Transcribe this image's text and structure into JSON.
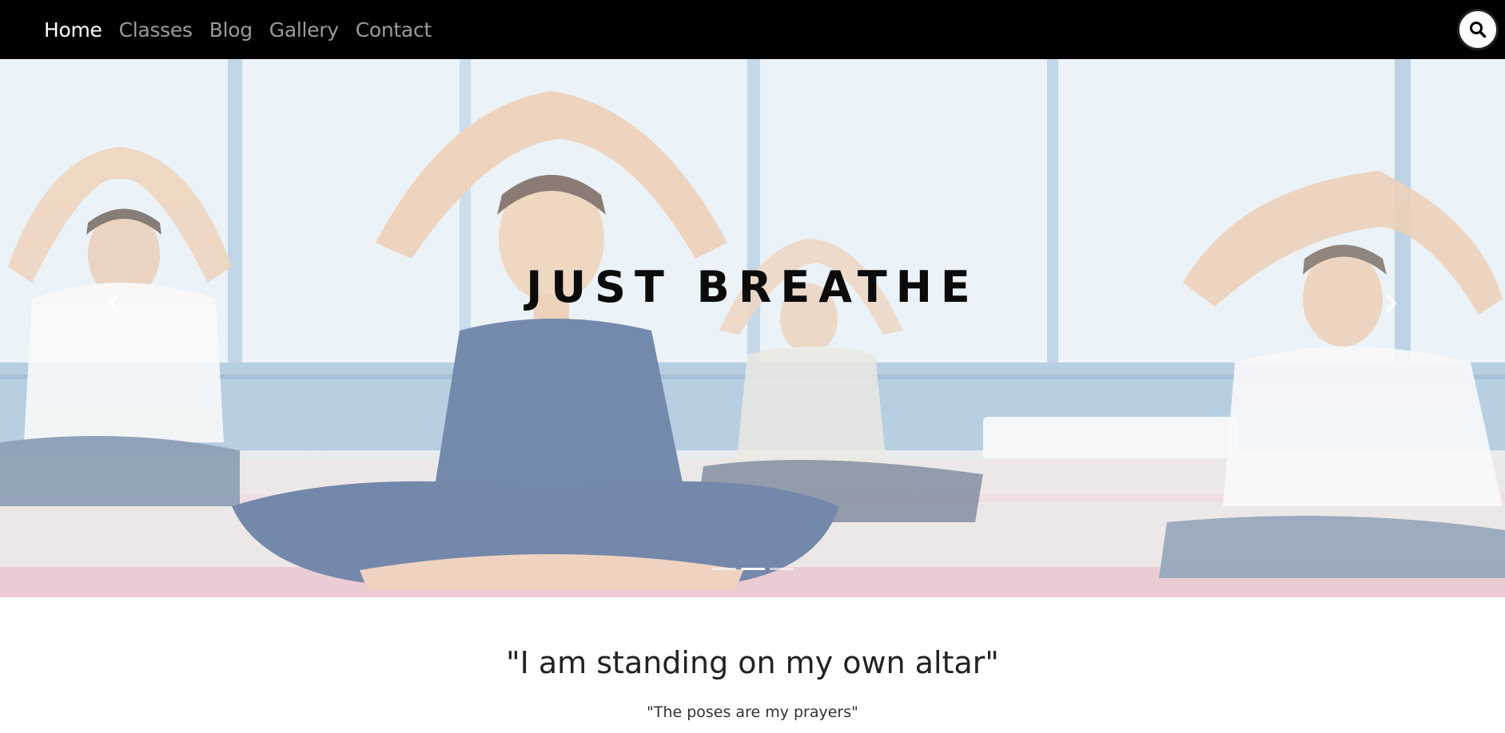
{
  "nav": {
    "items": [
      {
        "label": "Home",
        "active": true
      },
      {
        "label": "Classes",
        "active": false
      },
      {
        "label": "Blog",
        "active": false
      },
      {
        "label": "Gallery",
        "active": false
      },
      {
        "label": "Contact",
        "active": false
      }
    ],
    "search_icon": "search-icon"
  },
  "hero": {
    "title": "JUST BREATHE",
    "prev_icon": "chevron-left-icon",
    "next_icon": "chevron-right-icon",
    "indicator_count": 3,
    "active_indicator": 1
  },
  "quote": {
    "main": "\"I am standing on my own altar\"",
    "sub": "\"The poses are my prayers\""
  },
  "colors": {
    "navbar_bg": "#000000",
    "nav_active": "#ffffff",
    "nav_inactive": "#9a9a9a",
    "title": "#0b0b0b"
  }
}
